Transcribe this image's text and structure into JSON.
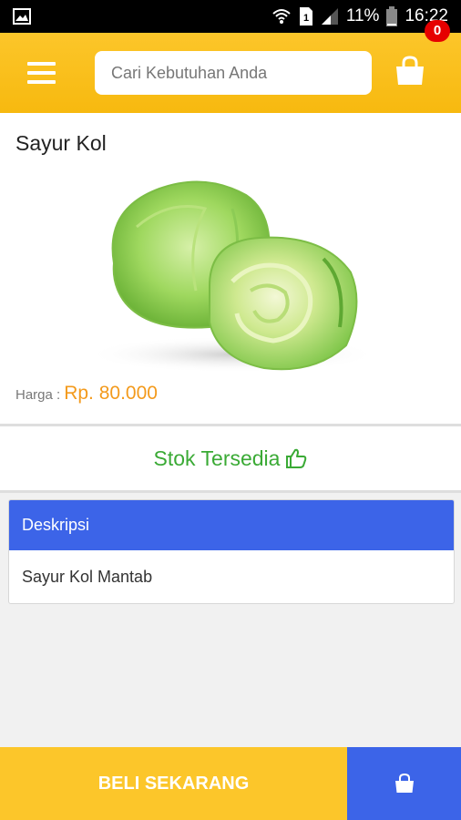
{
  "status_bar": {
    "battery": "11%",
    "time": "16:22",
    "sim_label": "1",
    "icons": [
      "gallery-icon",
      "wifi-icon",
      "sim-icon",
      "signal-icon",
      "battery-icon"
    ]
  },
  "header": {
    "search_placeholder": "Cari Kebutuhan Anda",
    "cart_count": "0",
    "background_color": "#fcc62a",
    "icons": [
      "menu-icon",
      "shopping-bag-icon"
    ]
  },
  "product": {
    "title": "Sayur Kol",
    "image": "cabbage-photo",
    "price_label": "Harga :",
    "price": "Rp. 80.000",
    "price_color": "#f39a1c"
  },
  "stock": {
    "text": "Stok Tersedia",
    "color": "#3aaa35",
    "icon": "thumbs-up-icon"
  },
  "description": {
    "header": "Deskripsi",
    "body": "Sayur Kol Mantab",
    "header_color": "#3c64e8"
  },
  "bottom_bar": {
    "buy_label": "BELI SEKARANG",
    "buy_color": "#fcc62a",
    "cart_color": "#3c64e8",
    "cart_icon": "shopping-bag-icon"
  }
}
